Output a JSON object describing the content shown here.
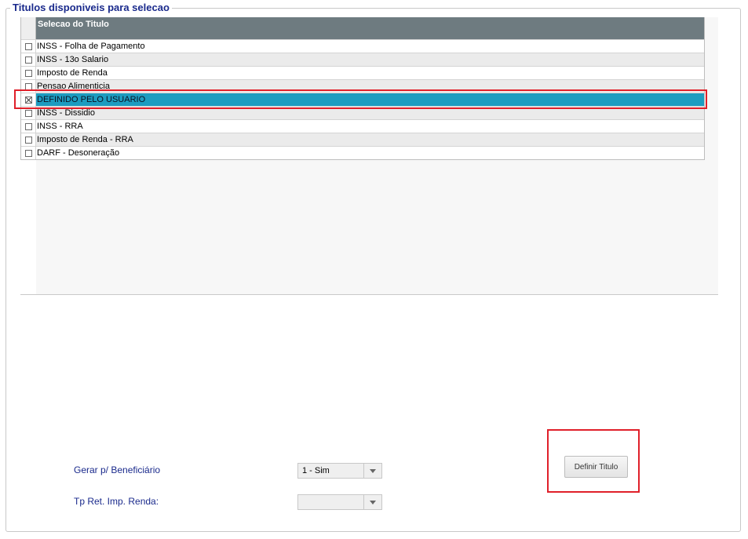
{
  "panel": {
    "legend": "Titulos disponiveis para selecao"
  },
  "grid": {
    "header": "Selecao do Titulo",
    "rows": [
      {
        "label": "INSS - Folha de Pagamento",
        "checked": false
      },
      {
        "label": "INSS - 13o Salario",
        "checked": false
      },
      {
        "label": "Imposto de Renda",
        "checked": false
      },
      {
        "label": "Pensao Alimenticia",
        "checked": false
      },
      {
        "label": "DEFINIDO PELO USUARIO",
        "checked": true,
        "selected": true
      },
      {
        "label": "INSS - Dissidio",
        "checked": false
      },
      {
        "label": "INSS - RRA",
        "checked": false
      },
      {
        "label": "Imposto de Renda - RRA",
        "checked": false
      },
      {
        "label": "DARF - Desoneração",
        "checked": false
      }
    ]
  },
  "form": {
    "beneficiario_label": "Gerar p/ Beneficiário",
    "beneficiario_value": "1 - Sim",
    "tp_ret_label": "Tp Ret. Imp. Renda:",
    "tp_ret_value": ""
  },
  "button": {
    "definir_label": "Definir Titulo"
  },
  "colors": {
    "selected_row": "#1c9cc0",
    "highlight": "#e0202a",
    "label": "#1a2a8c"
  }
}
